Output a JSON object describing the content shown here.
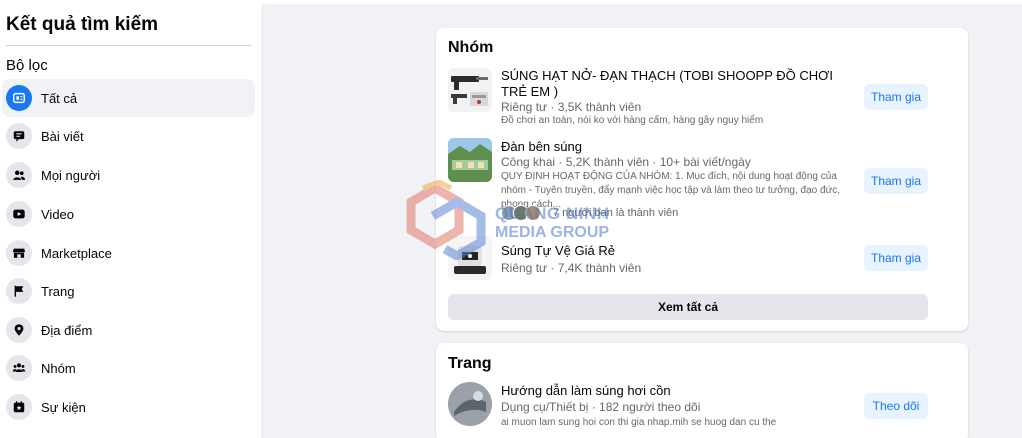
{
  "sidebar": {
    "title": "Kết quả tìm kiếm",
    "filter_label": "Bộ lọc",
    "items": [
      {
        "label": "Tất cả",
        "icon": "feed-icon",
        "active": true
      },
      {
        "label": "Bài viết",
        "icon": "posts-icon"
      },
      {
        "label": "Mọi người",
        "icon": "people-icon"
      },
      {
        "label": "Video",
        "icon": "video-icon"
      },
      {
        "label": "Marketplace",
        "icon": "marketplace-icon"
      },
      {
        "label": "Trang",
        "icon": "flag-icon"
      },
      {
        "label": "Địa điểm",
        "icon": "location-pin-icon"
      },
      {
        "label": "Nhóm",
        "icon": "groups-icon"
      },
      {
        "label": "Sự kiện",
        "icon": "calendar-star-icon"
      }
    ]
  },
  "groups_card": {
    "title": "Nhóm",
    "items": [
      {
        "name": "SÚNG HẠT NỞ- ĐẠN THẠCH (TOBI SHOOPP ĐỒ CHƠI TRẺ EM )",
        "meta": "Riêng tư · 3,5K thành viên",
        "desc": "Đồ chơi an toàn, nói ko với hàng cấm, hàng gây nguy hiểm",
        "button": "Tham gia"
      },
      {
        "name": "Đàn bên súng",
        "meta": "Công khai · 5,2K thành viên · 10+ bài viết/ngày",
        "desc": "QUY ĐỊNH HOẠT ĐỘNG CỦA NHÓM: 1. Mục đích, nội dung hoạt động của nhóm - Tuyên truyền, đẩy mạnh việc học tập và làm theo tư tưởng, đạo đức, phong cách...",
        "friends": "7 người bạn là thành viên",
        "button": "Tham gia"
      },
      {
        "name": "Súng Tự Vệ Giá Rẻ",
        "meta": "Riêng tư · 7,4K thành viên",
        "button": "Tham gia"
      }
    ],
    "see_all": "Xem tất cả"
  },
  "pages_card": {
    "title": "Trang",
    "items": [
      {
        "name": "Hướng dẫn làm súng hơi cồn",
        "meta": "Dụng cụ/Thiết bị · 182 người theo dõi",
        "desc": "ai muon lam sung hoi con thi gia nhap.mih se huog dan cu the",
        "button": "Theo dõi"
      }
    ]
  },
  "watermark": {
    "line1": "QUANG NINH",
    "line2": "MEDIA GROUP"
  },
  "colors": {
    "accent": "#1877f2",
    "button_bg": "#e7f3ff",
    "page_bg": "#f0f2f5"
  }
}
